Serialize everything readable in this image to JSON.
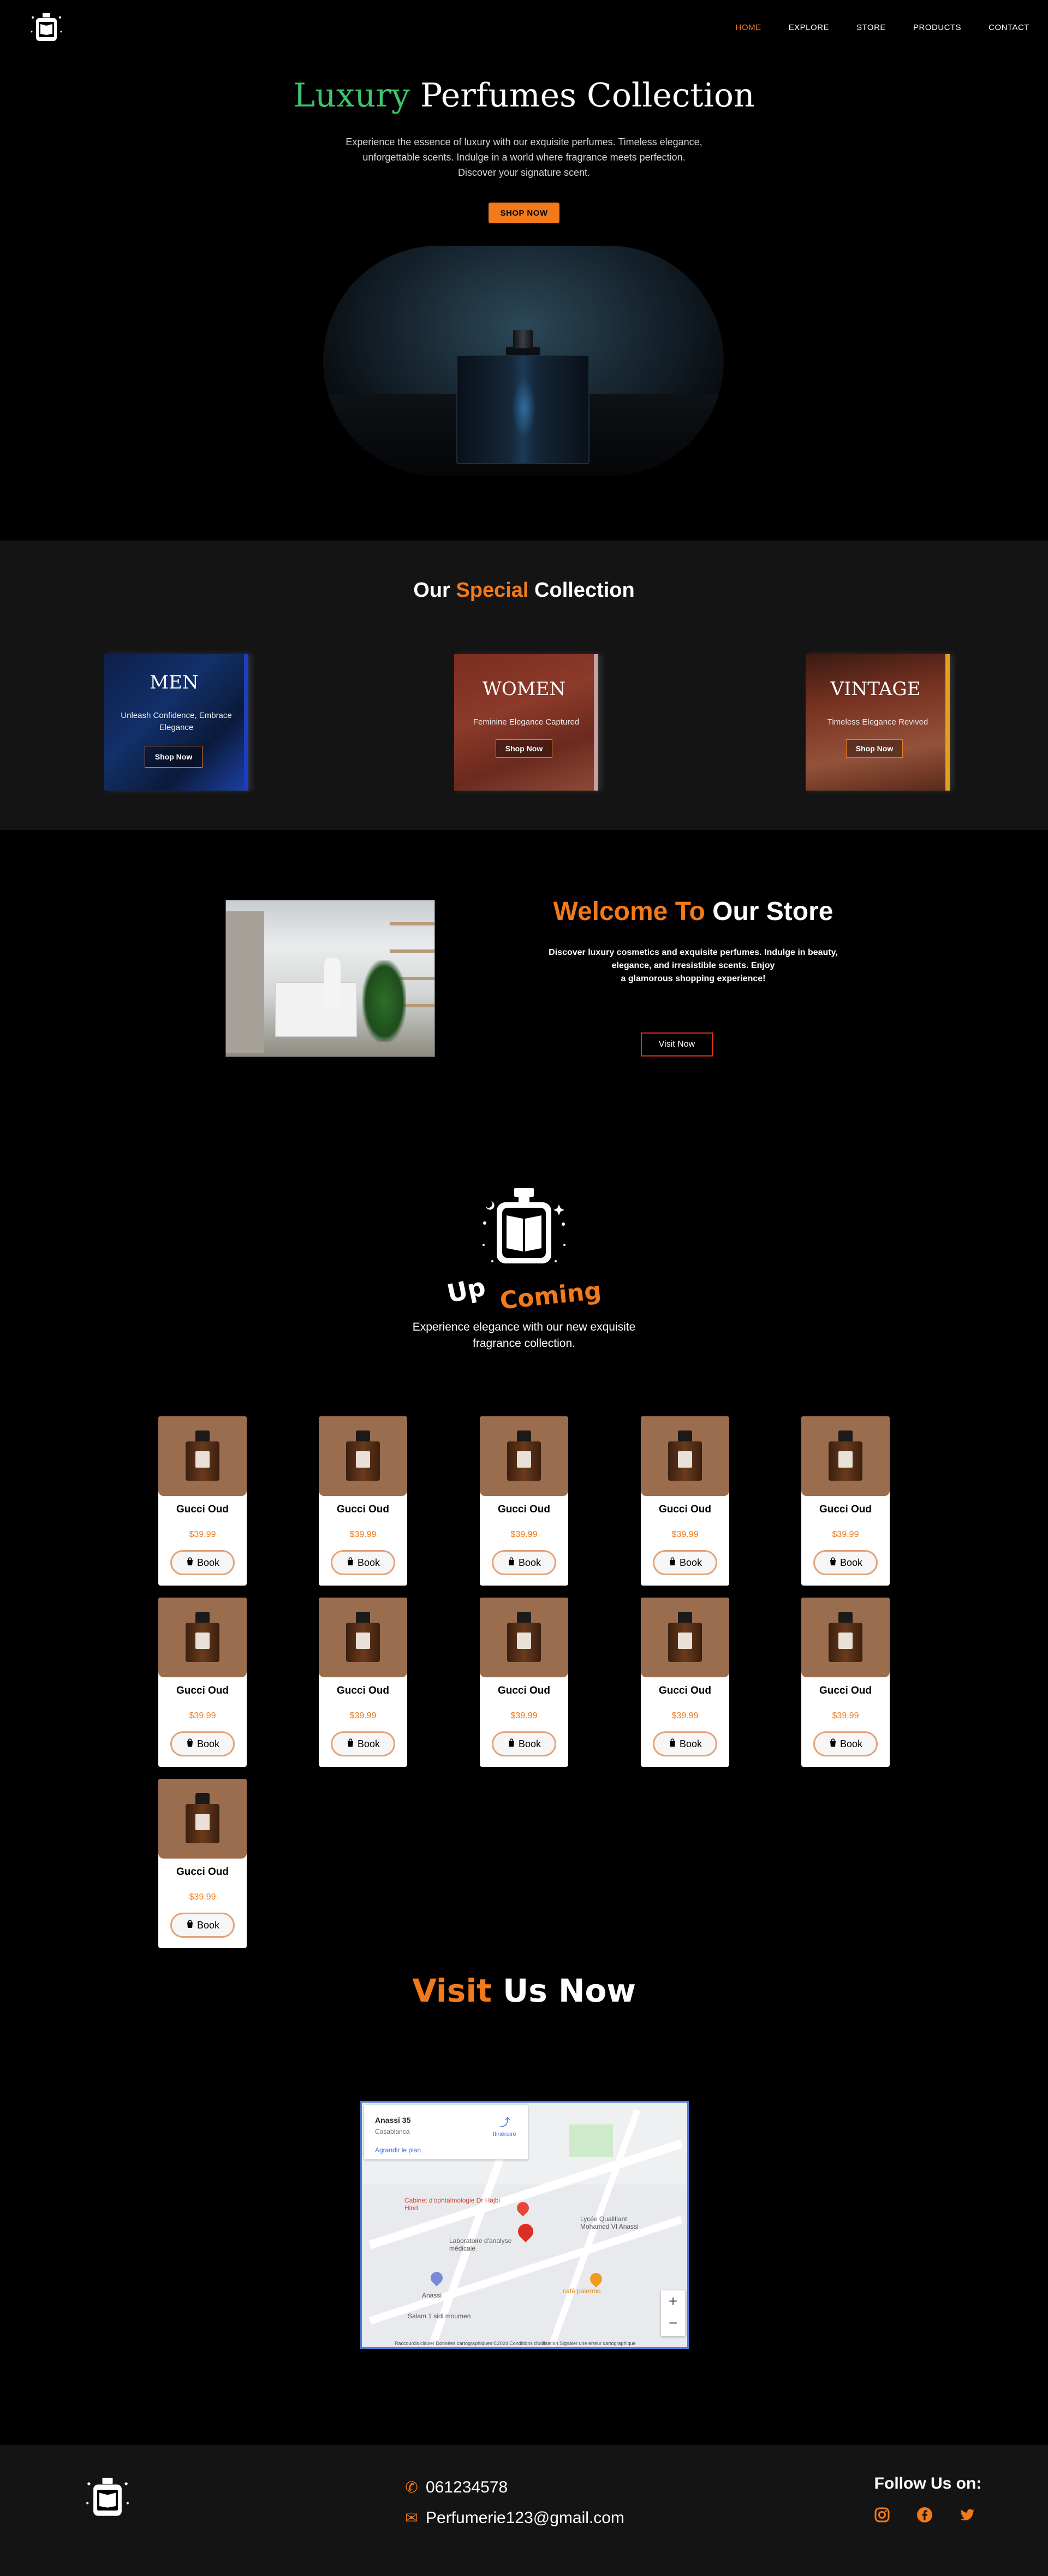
{
  "nav": {
    "items": [
      "HOME",
      "EXPLORE",
      "STORE",
      "PRODUCTS",
      "CONTACT"
    ],
    "active_index": 0
  },
  "hero": {
    "title_highlight": "Luxury",
    "title_rest": " Perfumes Collection",
    "text_lines": [
      "Experience the essence of luxury with our exquisite perfumes. Timeless elegance,",
      "unforgettable scents. Indulge in a world where fragrance meets perfection.",
      "Discover your signature scent."
    ],
    "button": "SHOP NOW"
  },
  "special": {
    "title_pre": "Our ",
    "title_highlight": "Special",
    "title_post": " Collection",
    "cards": [
      {
        "title": "MEN",
        "subtitle": "Unleash Confidence, Embrace Elegance",
        "button": "Shop Now"
      },
      {
        "title": "WOMEN",
        "subtitle": "Feminine Elegance Captured",
        "button": "Shop Now"
      },
      {
        "title": "VINTAGE",
        "subtitle": "Timeless Elegance Revived",
        "button": "Shop Now"
      }
    ]
  },
  "welcome": {
    "title_highlight": "Welcome To",
    "title_rest": " Our Store",
    "text_lines": [
      "Discover luxury cosmetics and exquisite perfumes. Indulge in beauty,",
      "elegance, and irresistible scents. Enjoy",
      "a glamorous shopping experience!"
    ],
    "button": "Visit Now"
  },
  "upcoming": {
    "word1": "Up",
    "word2": "Coming",
    "subtitle_lines": [
      "Experience elegance with our new exquisite",
      "fragrance collection."
    ],
    "products": [
      {
        "name": "Gucci Oud",
        "price": "$39.99",
        "button": "Book"
      },
      {
        "name": "Gucci Oud",
        "price": "$39.99",
        "button": "Book"
      },
      {
        "name": "Gucci Oud",
        "price": "$39.99",
        "button": "Book"
      },
      {
        "name": "Gucci Oud",
        "price": "$39.99",
        "button": "Book"
      },
      {
        "name": "Gucci Oud",
        "price": "$39.99",
        "button": "Book"
      },
      {
        "name": "Gucci Oud",
        "price": "$39.99",
        "button": "Book"
      },
      {
        "name": "Gucci Oud",
        "price": "$39.99",
        "button": "Book"
      },
      {
        "name": "Gucci Oud",
        "price": "$39.99",
        "button": "Book"
      },
      {
        "name": "Gucci Oud",
        "price": "$39.99",
        "button": "Book"
      },
      {
        "name": "Gucci Oud",
        "price": "$39.99",
        "button": "Book"
      },
      {
        "name": "Gucci Oud",
        "price": "$39.99",
        "button": "Book"
      }
    ]
  },
  "visit": {
    "title_highlight": "Visit",
    "title_rest": " Us Now",
    "map": {
      "place_name": "Anassi 35",
      "place_city": "Casablanca",
      "directions": "Itinéraire",
      "enlarge": "Agrandir le plan",
      "labels": {
        "clinic": "Cabinet d'ophtalmologie Dr Hajbi Hind",
        "lab": "Laboratoire d'analyse médicale",
        "lycee": "Lycée Qualifiant Mohamed VI Anassi",
        "cafe": "café palermo",
        "salam": "Salam 1 sidi moumen",
        "anassi": "Anassi"
      },
      "footer": "Raccourcis clavier   Données cartographiques ©2024   Conditions d'utilisation   Signaler une erreur cartographique"
    }
  },
  "footer": {
    "phone": "061234578",
    "email": "Perfumerie123@gmail.com",
    "follow": "Follow Us on:",
    "social_icons": [
      "instagram-icon",
      "facebook-icon",
      "twitter-icon"
    ]
  },
  "colors": {
    "accent": "#f27a1a",
    "green": "#3ec46d",
    "background": "#000000",
    "section_dark": "#141414"
  }
}
